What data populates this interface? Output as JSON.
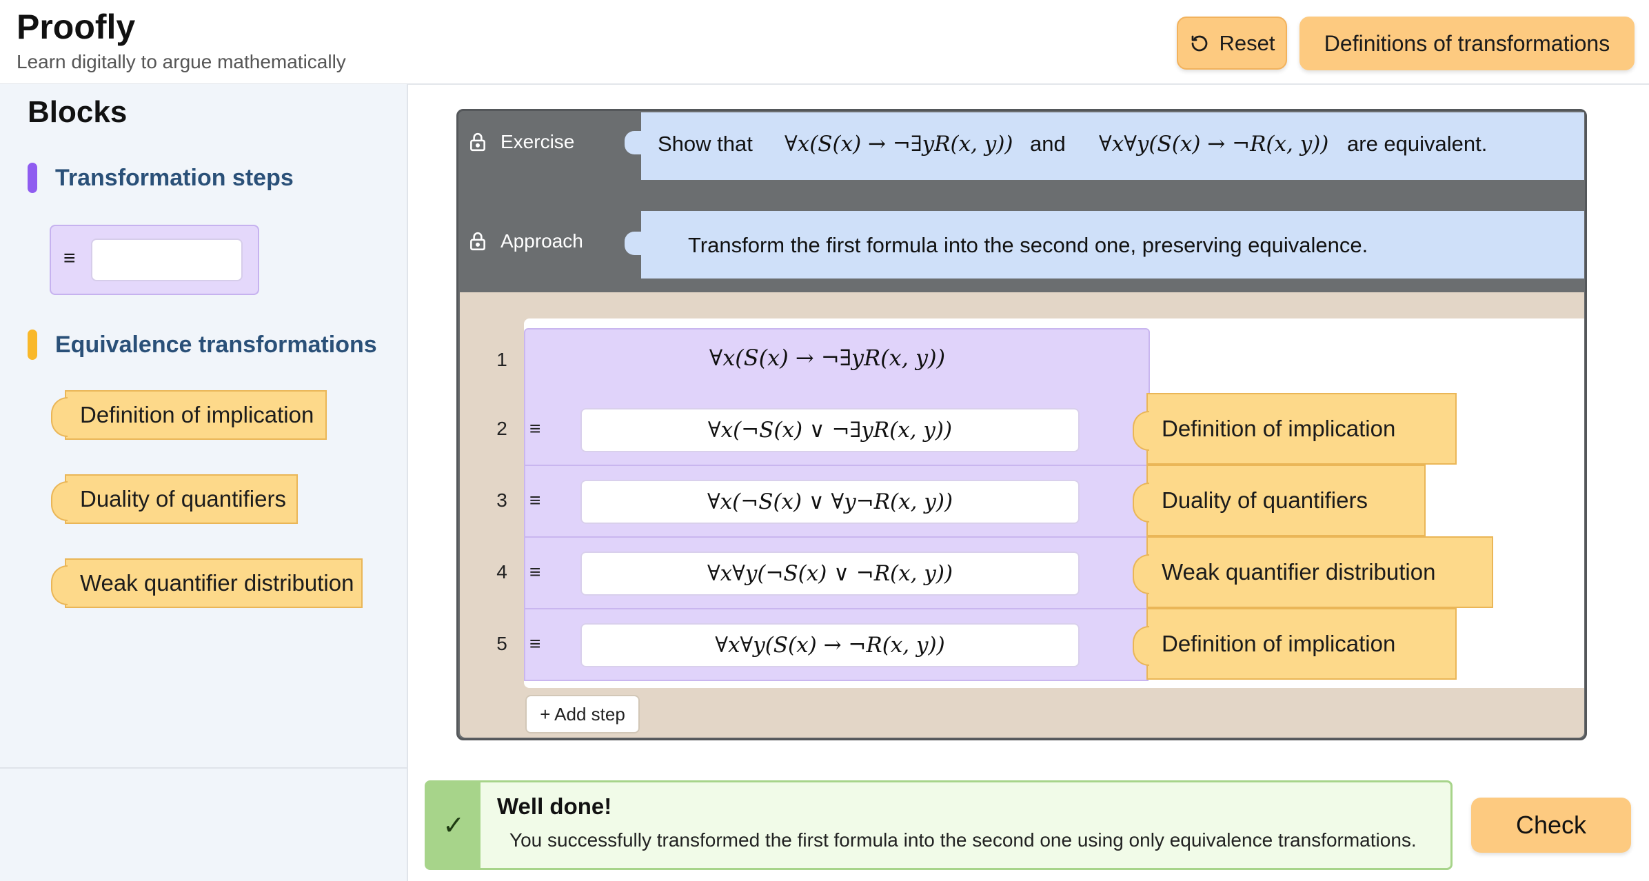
{
  "header": {
    "title": "Proofly",
    "subtitle": "Learn digitally to argue mathematically",
    "reset_label": "Reset",
    "definitions_label": "Definitions of transformations"
  },
  "sidebar": {
    "title": "Blocks",
    "category_steps": "Transformation steps",
    "category_equivalence": "Equivalence transformations",
    "step_symbol": "≡",
    "rules": [
      "Definition of implication",
      "Duality of quantifiers",
      "Weak quantifier distribution"
    ],
    "colors": {
      "steps": "#8f5cf0",
      "equivalence": "#f9b82a"
    }
  },
  "exercise": {
    "label": "Exercise",
    "prefix": "Show that",
    "formula_a": "∀x(S(x) → ¬∃yR(x, y))",
    "connector": "and",
    "formula_b": "∀x∀y(S(x) → ¬R(x, y))",
    "suffix": "are equivalent."
  },
  "approach": {
    "label": "Approach",
    "text": "Transform the first formula into the second one, preserving equivalence."
  },
  "proof": {
    "start": {
      "number": "1",
      "formula": "∀x(S(x) → ¬∃yR(x, y))"
    },
    "steps": [
      {
        "number": "2",
        "symbol": "≡",
        "formula": "∀x(¬S(x) ∨ ¬∃yR(x, y))",
        "rule": "Definition of implication"
      },
      {
        "number": "3",
        "symbol": "≡",
        "formula": "∀x(¬S(x) ∨ ∀y¬R(x, y))",
        "rule": "Duality of quantifiers"
      },
      {
        "number": "4",
        "symbol": "≡",
        "formula": "∀x∀y(¬S(x) ∨ ¬R(x, y))",
        "rule": "Weak quantifier distribution"
      },
      {
        "number": "5",
        "symbol": "≡",
        "formula": "∀x∀y(S(x) → ¬R(x, y))",
        "rule": "Definition of implication"
      }
    ],
    "add_step_label": "+ Add step"
  },
  "feedback": {
    "icon": "✓",
    "title": "Well done!",
    "text": "You successfully transformed the first formula into the second one using only equivalence transformations."
  },
  "check_label": "Check"
}
